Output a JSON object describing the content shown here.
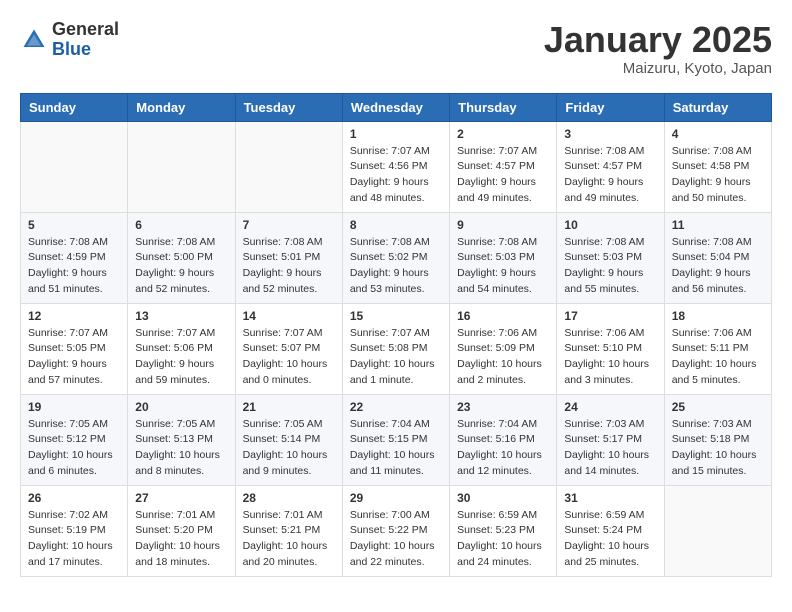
{
  "header": {
    "logo_general": "General",
    "logo_blue": "Blue",
    "month_title": "January 2025",
    "location": "Maizuru, Kyoto, Japan"
  },
  "days_of_week": [
    "Sunday",
    "Monday",
    "Tuesday",
    "Wednesday",
    "Thursday",
    "Friday",
    "Saturday"
  ],
  "weeks": [
    [
      {
        "day": "",
        "info": ""
      },
      {
        "day": "",
        "info": ""
      },
      {
        "day": "",
        "info": ""
      },
      {
        "day": "1",
        "info": "Sunrise: 7:07 AM\nSunset: 4:56 PM\nDaylight: 9 hours\nand 48 minutes."
      },
      {
        "day": "2",
        "info": "Sunrise: 7:07 AM\nSunset: 4:57 PM\nDaylight: 9 hours\nand 49 minutes."
      },
      {
        "day": "3",
        "info": "Sunrise: 7:08 AM\nSunset: 4:57 PM\nDaylight: 9 hours\nand 49 minutes."
      },
      {
        "day": "4",
        "info": "Sunrise: 7:08 AM\nSunset: 4:58 PM\nDaylight: 9 hours\nand 50 minutes."
      }
    ],
    [
      {
        "day": "5",
        "info": "Sunrise: 7:08 AM\nSunset: 4:59 PM\nDaylight: 9 hours\nand 51 minutes."
      },
      {
        "day": "6",
        "info": "Sunrise: 7:08 AM\nSunset: 5:00 PM\nDaylight: 9 hours\nand 52 minutes."
      },
      {
        "day": "7",
        "info": "Sunrise: 7:08 AM\nSunset: 5:01 PM\nDaylight: 9 hours\nand 52 minutes."
      },
      {
        "day": "8",
        "info": "Sunrise: 7:08 AM\nSunset: 5:02 PM\nDaylight: 9 hours\nand 53 minutes."
      },
      {
        "day": "9",
        "info": "Sunrise: 7:08 AM\nSunset: 5:03 PM\nDaylight: 9 hours\nand 54 minutes."
      },
      {
        "day": "10",
        "info": "Sunrise: 7:08 AM\nSunset: 5:03 PM\nDaylight: 9 hours\nand 55 minutes."
      },
      {
        "day": "11",
        "info": "Sunrise: 7:08 AM\nSunset: 5:04 PM\nDaylight: 9 hours\nand 56 minutes."
      }
    ],
    [
      {
        "day": "12",
        "info": "Sunrise: 7:07 AM\nSunset: 5:05 PM\nDaylight: 9 hours\nand 57 minutes."
      },
      {
        "day": "13",
        "info": "Sunrise: 7:07 AM\nSunset: 5:06 PM\nDaylight: 9 hours\nand 59 minutes."
      },
      {
        "day": "14",
        "info": "Sunrise: 7:07 AM\nSunset: 5:07 PM\nDaylight: 10 hours\nand 0 minutes."
      },
      {
        "day": "15",
        "info": "Sunrise: 7:07 AM\nSunset: 5:08 PM\nDaylight: 10 hours\nand 1 minute."
      },
      {
        "day": "16",
        "info": "Sunrise: 7:06 AM\nSunset: 5:09 PM\nDaylight: 10 hours\nand 2 minutes."
      },
      {
        "day": "17",
        "info": "Sunrise: 7:06 AM\nSunset: 5:10 PM\nDaylight: 10 hours\nand 3 minutes."
      },
      {
        "day": "18",
        "info": "Sunrise: 7:06 AM\nSunset: 5:11 PM\nDaylight: 10 hours\nand 5 minutes."
      }
    ],
    [
      {
        "day": "19",
        "info": "Sunrise: 7:05 AM\nSunset: 5:12 PM\nDaylight: 10 hours\nand 6 minutes."
      },
      {
        "day": "20",
        "info": "Sunrise: 7:05 AM\nSunset: 5:13 PM\nDaylight: 10 hours\nand 8 minutes."
      },
      {
        "day": "21",
        "info": "Sunrise: 7:05 AM\nSunset: 5:14 PM\nDaylight: 10 hours\nand 9 minutes."
      },
      {
        "day": "22",
        "info": "Sunrise: 7:04 AM\nSunset: 5:15 PM\nDaylight: 10 hours\nand 11 minutes."
      },
      {
        "day": "23",
        "info": "Sunrise: 7:04 AM\nSunset: 5:16 PM\nDaylight: 10 hours\nand 12 minutes."
      },
      {
        "day": "24",
        "info": "Sunrise: 7:03 AM\nSunset: 5:17 PM\nDaylight: 10 hours\nand 14 minutes."
      },
      {
        "day": "25",
        "info": "Sunrise: 7:03 AM\nSunset: 5:18 PM\nDaylight: 10 hours\nand 15 minutes."
      }
    ],
    [
      {
        "day": "26",
        "info": "Sunrise: 7:02 AM\nSunset: 5:19 PM\nDaylight: 10 hours\nand 17 minutes."
      },
      {
        "day": "27",
        "info": "Sunrise: 7:01 AM\nSunset: 5:20 PM\nDaylight: 10 hours\nand 18 minutes."
      },
      {
        "day": "28",
        "info": "Sunrise: 7:01 AM\nSunset: 5:21 PM\nDaylight: 10 hours\nand 20 minutes."
      },
      {
        "day": "29",
        "info": "Sunrise: 7:00 AM\nSunset: 5:22 PM\nDaylight: 10 hours\nand 22 minutes."
      },
      {
        "day": "30",
        "info": "Sunrise: 6:59 AM\nSunset: 5:23 PM\nDaylight: 10 hours\nand 24 minutes."
      },
      {
        "day": "31",
        "info": "Sunrise: 6:59 AM\nSunset: 5:24 PM\nDaylight: 10 hours\nand 25 minutes."
      },
      {
        "day": "",
        "info": ""
      }
    ]
  ]
}
